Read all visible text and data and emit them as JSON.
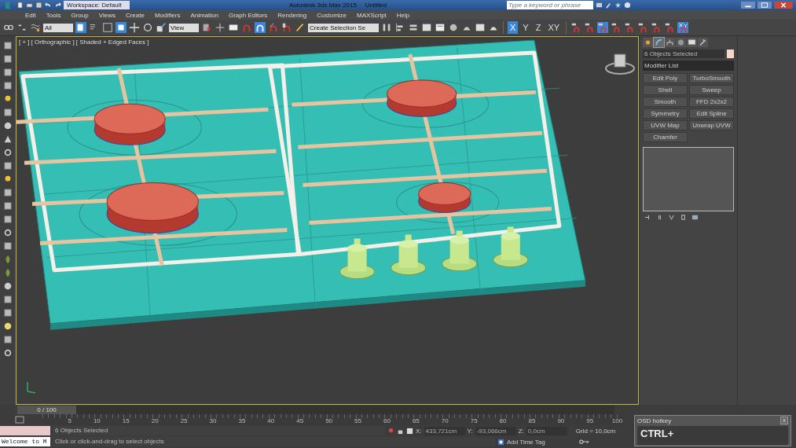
{
  "title_bar": {
    "workspace": "Workspace: Default",
    "app_title": "Autodesk 3ds Max 2015",
    "document": "Untitled",
    "search": {
      "placeholder": "Type a keyword or phrase"
    }
  },
  "menu": [
    "Edit",
    "Tools",
    "Group",
    "Views",
    "Create",
    "Modifiers",
    "Animation",
    "Graph Editors",
    "Rendering",
    "Customize",
    "MAXScript",
    "Help"
  ],
  "toolbar": {
    "selection_filter": "All",
    "reference_coord": "View",
    "named_selection": "Create Selection Se",
    "axis_buttons": [
      {
        "label": "X",
        "selected": true
      },
      {
        "label": "Y",
        "selected": false
      },
      {
        "label": "Z",
        "selected": false
      },
      {
        "label": "XY",
        "selected": false
      }
    ]
  },
  "viewport": {
    "labels": [
      "[ + ]",
      "[ Orthographic ]",
      "[ Shaded + Edged Faces ]"
    ]
  },
  "command_panel": {
    "tabs": [
      {
        "selected": false
      },
      {
        "selected": true
      },
      {
        "selected": false
      },
      {
        "selected": false
      },
      {
        "selected": false
      },
      {
        "selected": false
      }
    ],
    "object_name": "6 Objects Selected",
    "modifier_list": "Modifier List",
    "modifier_buttons": [
      "Edit Poly",
      "TurboSmooth",
      "Shell",
      "Sweep",
      "Smooth",
      "FFD 2x2x2",
      "Symmetry",
      "Edit Spline",
      "UVW Map",
      "Unwrap UVW",
      "Chamfer"
    ]
  },
  "timeline": {
    "frame": "0 / 100",
    "level": 0,
    "ticks": [
      "5",
      "10",
      "15",
      "20",
      "25",
      "30",
      "35",
      "40",
      "45",
      "50",
      "55",
      "60",
      "65",
      "70",
      "75",
      "80",
      "85",
      "90",
      "95",
      "100"
    ]
  },
  "status": {
    "mini_listener": "Welcome to M",
    "selection": "6 Objects Selected",
    "prompt": "Click or click-and-drag to select objects",
    "x_label": "X:",
    "x": "433,721cm",
    "y_label": "Y:",
    "y": "-93,066cm",
    "z_label": "Z:",
    "z": "0,0cm",
    "grid": "Grid = 10,0cm",
    "time_tag": "Add Time Tag"
  },
  "osd": {
    "title": "OSD hotkey",
    "text": "CTRL+",
    "close": "x"
  }
}
